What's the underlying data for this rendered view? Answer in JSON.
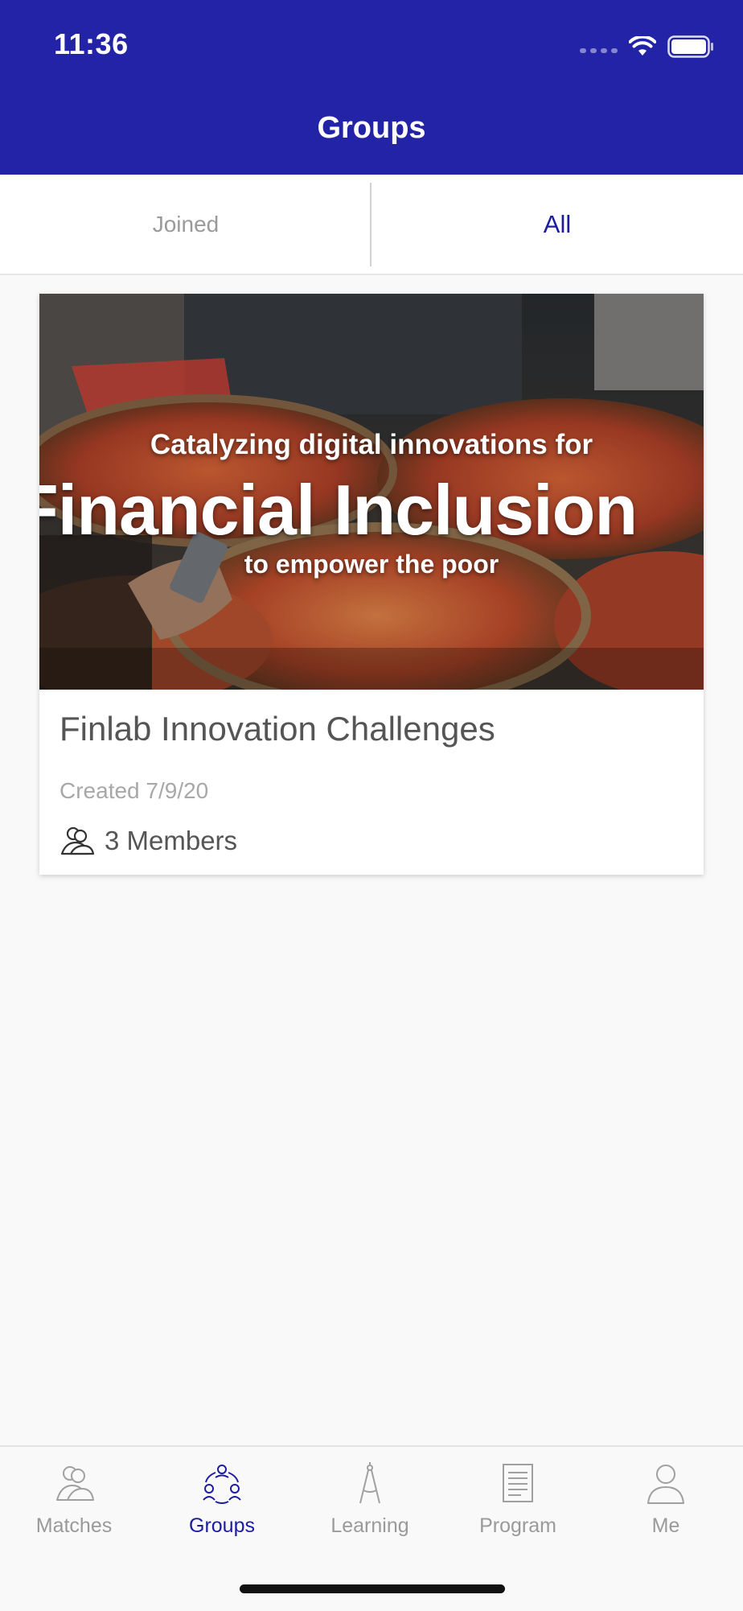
{
  "status_bar": {
    "time": "11:36"
  },
  "header": {
    "title": "Groups",
    "background_color": "#2323a8"
  },
  "segments": [
    {
      "label": "Joined",
      "selected": false
    },
    {
      "label": "All",
      "selected": true
    }
  ],
  "groups": [
    {
      "banner": {
        "line1": "Catalyzing digital innovations for",
        "line2": "Financial Inclusion",
        "line3": "to empower the poor"
      },
      "title": "Finlab Innovation Challenges",
      "created": "Created 7/9/20",
      "members": "3 Members",
      "members_icon": "people-icon"
    }
  ],
  "tab_bar": {
    "items": [
      {
        "label": "Matches",
        "icon": "people-icon",
        "active": false
      },
      {
        "label": "Groups",
        "icon": "group-network-icon",
        "active": true
      },
      {
        "label": "Learning",
        "icon": "compass-icon",
        "active": false
      },
      {
        "label": "Program",
        "icon": "document-icon",
        "active": false
      },
      {
        "label": "Me",
        "icon": "person-icon",
        "active": false
      }
    ]
  },
  "colors": {
    "accent": "#1c1ca0",
    "inactive": "#9a9a9a"
  }
}
